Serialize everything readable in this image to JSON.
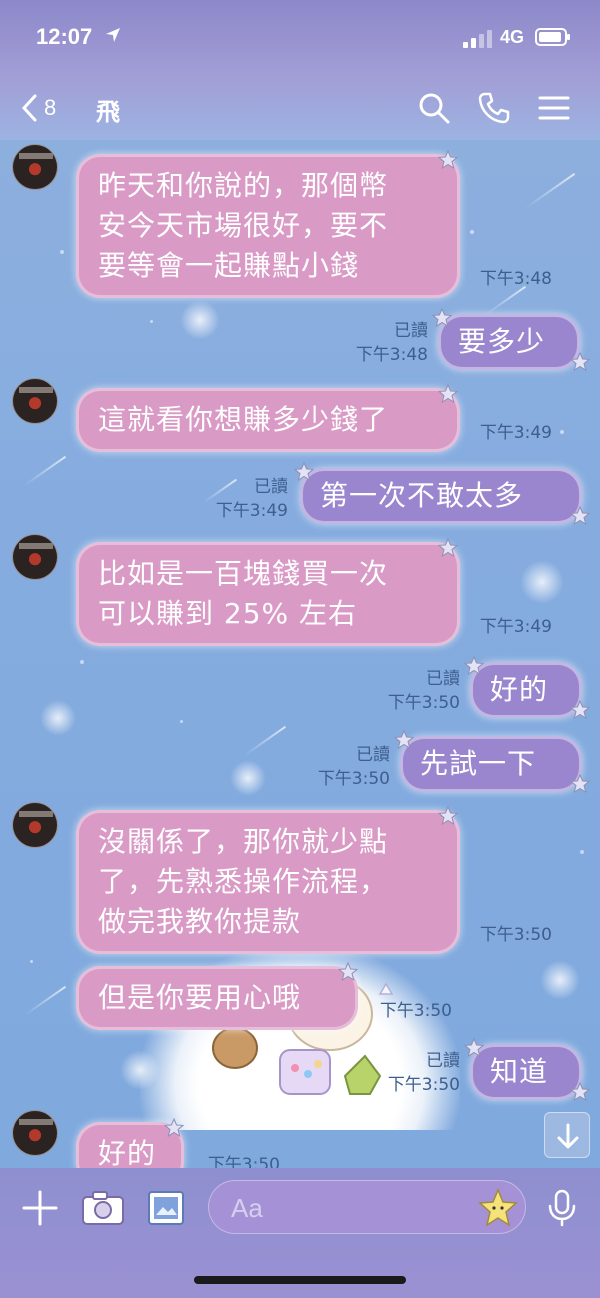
{
  "status_bar": {
    "time": "12:07",
    "network": "4G"
  },
  "header": {
    "back_count": "8",
    "title": "飛"
  },
  "messages": [
    {
      "dir": "in",
      "text": "昨天和你說的，那個幣\n安今天市場很好，要不\n要等會一起賺點小錢",
      "time": "下午3:48"
    },
    {
      "dir": "out",
      "text": "要多少",
      "read": "已讀",
      "time": "下午3:48"
    },
    {
      "dir": "in",
      "text": "這就看你想賺多少錢了",
      "time": "下午3:49"
    },
    {
      "dir": "out",
      "text": "第一次不敢太多",
      "read": "已讀",
      "time": "下午3:49"
    },
    {
      "dir": "in",
      "text": "比如是一百塊錢買一次\n可以賺到 25% 左右",
      "time": "下午3:49"
    },
    {
      "dir": "out",
      "text": "好的",
      "read": "已讀",
      "time": "下午3:50"
    },
    {
      "dir": "out",
      "text": "先試一下",
      "read": "已讀",
      "time": "下午3:50"
    },
    {
      "dir": "in",
      "text": "沒關係了，那你就少點\n了，先熟悉操作流程，\n做完我教你提款",
      "time": "下午3:50"
    },
    {
      "dir": "in",
      "text": "但是你要用心哦",
      "time": "下午3:50"
    },
    {
      "dir": "out",
      "text": "知道",
      "read": "已讀",
      "time": "下午3:50"
    },
    {
      "dir": "in",
      "text": "好的",
      "time": "下午3:50"
    }
  ],
  "input": {
    "placeholder": "Aa"
  },
  "icons": {
    "back": "chevron-left-icon",
    "search": "search-icon",
    "call": "phone-icon",
    "menu": "hamburger-menu-icon",
    "add": "plus-icon",
    "camera": "camera-icon",
    "image": "image-icon",
    "sticker": "star-sticker-icon",
    "voice": "microphone-icon",
    "scroll": "arrow-down-icon"
  },
  "colors": {
    "incoming_bubble": "#d99bc6",
    "outgoing_bubble": "#9a86cf",
    "meta_text": "#3e5f8e",
    "background": "#86acdf"
  }
}
